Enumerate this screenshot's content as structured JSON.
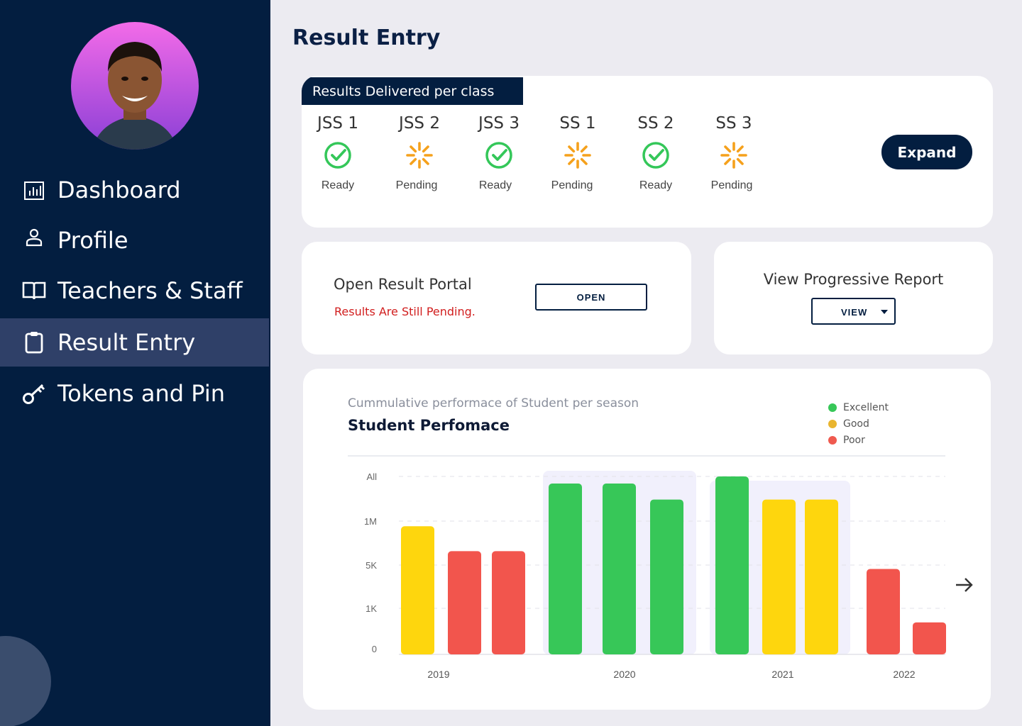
{
  "sidebar": {
    "items": [
      {
        "label": "Dashboard",
        "icon": "bar-chart-icon",
        "active": false
      },
      {
        "label": "Profile",
        "icon": "user-icon",
        "active": false
      },
      {
        "label": "Teachers & Staff",
        "icon": "book-icon",
        "active": false
      },
      {
        "label": "Result Entry",
        "icon": "clipboard-icon",
        "active": true
      },
      {
        "label": "Tokens and Pin",
        "icon": "key-icon",
        "active": false
      }
    ]
  },
  "page": {
    "title": "Result Entry"
  },
  "delivery": {
    "header": "Results Delivered per class",
    "classes": [
      {
        "name": "JSS 1",
        "status": "Ready"
      },
      {
        "name": "JSS 2",
        "status": "Pending"
      },
      {
        "name": "JSS 3",
        "status": "Ready"
      },
      {
        "name": "SS 1",
        "status": "Pending"
      },
      {
        "name": "SS 2",
        "status": "Ready"
      },
      {
        "name": "SS 3",
        "status": "Pending"
      }
    ],
    "expand_label": "Expand"
  },
  "portal": {
    "title": "Open Result Portal",
    "warning": "Results Are Still Pending.",
    "button_label": "OPEN"
  },
  "report": {
    "title": "View Progressive Report",
    "button_label": "VIEW"
  },
  "colors": {
    "navy": "#031e40",
    "ready": "#34c759",
    "pending": "#f5a11c",
    "excellent": "#37c758",
    "good": "#fed60d",
    "poor": "#f2554d"
  },
  "chart_data": {
    "type": "bar",
    "subtitle": "Cummulative performace of Student per season",
    "title": "Student Perfomace",
    "legend": [
      "Excellent",
      "Good",
      "Poor"
    ],
    "legend_position": "top-right",
    "y_tick_labels": [
      "0",
      "1K",
      "5K",
      "1M",
      "All"
    ],
    "x_groups": [
      "2019",
      "2020",
      "2021",
      "2022"
    ],
    "grid": true,
    "bars": [
      {
        "group": "2019",
        "category": "Good",
        "level": 0.72
      },
      {
        "group": "2019",
        "category": "Poor",
        "level": 0.58
      },
      {
        "group": "2019",
        "category": "Poor",
        "level": 0.58
      },
      {
        "group": "2020",
        "category": "Excellent",
        "level": 0.96
      },
      {
        "group": "2020",
        "category": "Excellent",
        "level": 0.96
      },
      {
        "group": "2020",
        "category": "Excellent",
        "level": 0.87
      },
      {
        "group": "2021",
        "category": "Excellent",
        "level": 1.0
      },
      {
        "group": "2021",
        "category": "Good",
        "level": 0.87
      },
      {
        "group": "2021",
        "category": "Good",
        "level": 0.87
      },
      {
        "group": "2022",
        "category": "Poor",
        "level": 0.48
      },
      {
        "group": "2022",
        "category": "Poor",
        "level": 0.18
      }
    ],
    "highlighted_groups": [
      "2020",
      "2021"
    ]
  }
}
